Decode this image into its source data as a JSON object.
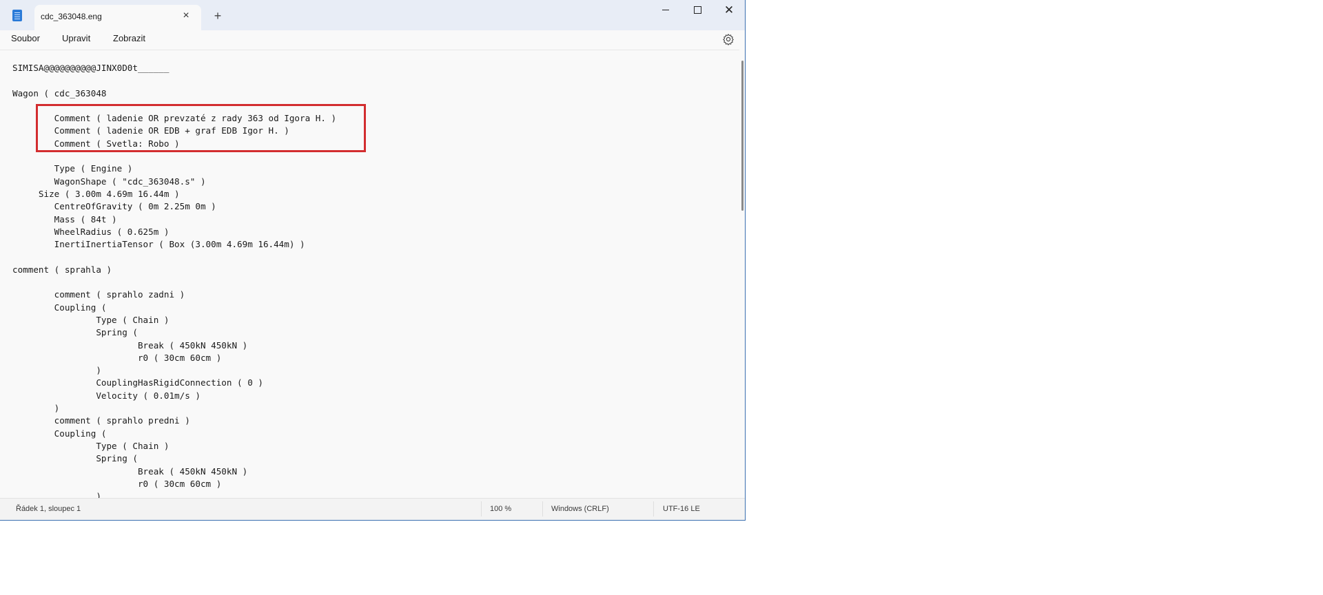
{
  "window": {
    "tab_title": "cdc_363048.eng",
    "tab_close_glyph": "×",
    "new_tab_glyph": "+",
    "close_glyph": "✕",
    "icons": {
      "app": "notepad-icon",
      "minimize": "minimize-icon",
      "maximize": "maximize-icon",
      "close": "close-icon",
      "settings": "gear-icon"
    }
  },
  "menu": {
    "file": "Soubor",
    "edit": "Upravit",
    "view": "Zobrazit"
  },
  "editor": {
    "content": "SIMISA@@@@@@@@@@JINX0D0t______\n\nWagon ( cdc_363048\n\n        Comment ( ladenie OR prevzaté z rady 363 od Igora H. )\n        Comment ( ladenie OR EDB + graf EDB Igor H. )\n        Comment ( Svetla: Robo )\n\n        Type ( Engine )\n        WagonShape ( \"cdc_363048.s\" )\n     Size ( 3.00m 4.69m 16.44m )\n        CentreOfGravity ( 0m 2.25m 0m )\n        Mass ( 84t )\n        WheelRadius ( 0.625m )\n        InertiInertiaTensor ( Box (3.00m 4.69m 16.44m) )\n\ncomment ( sprahla )\n\n        comment ( sprahlo zadni )\n        Coupling (\n                Type ( Chain )\n                Spring (\n                        Break ( 450kN 450kN )\n                        r0 ( 30cm 60cm )\n                )\n                CouplingHasRigidConnection ( 0 )\n                Velocity ( 0.01m/s )\n        )\n        comment ( sprahlo predni )\n        Coupling (\n                Type ( Chain )\n                Spring (\n                        Break ( 450kN 450kN )\n                        r0 ( 30cm 60cm )\n                )",
    "highlight_color": "#d32d2f"
  },
  "status": {
    "position": "Řádek 1, sloupec 1",
    "zoom": "100 %",
    "line_ending": "Windows (CRLF)",
    "encoding": "UTF-16 LE"
  },
  "colors": {
    "titlebar": "#e8edf6",
    "window_border": "#3a6fb0",
    "editor_bg": "#f9f9f9"
  }
}
